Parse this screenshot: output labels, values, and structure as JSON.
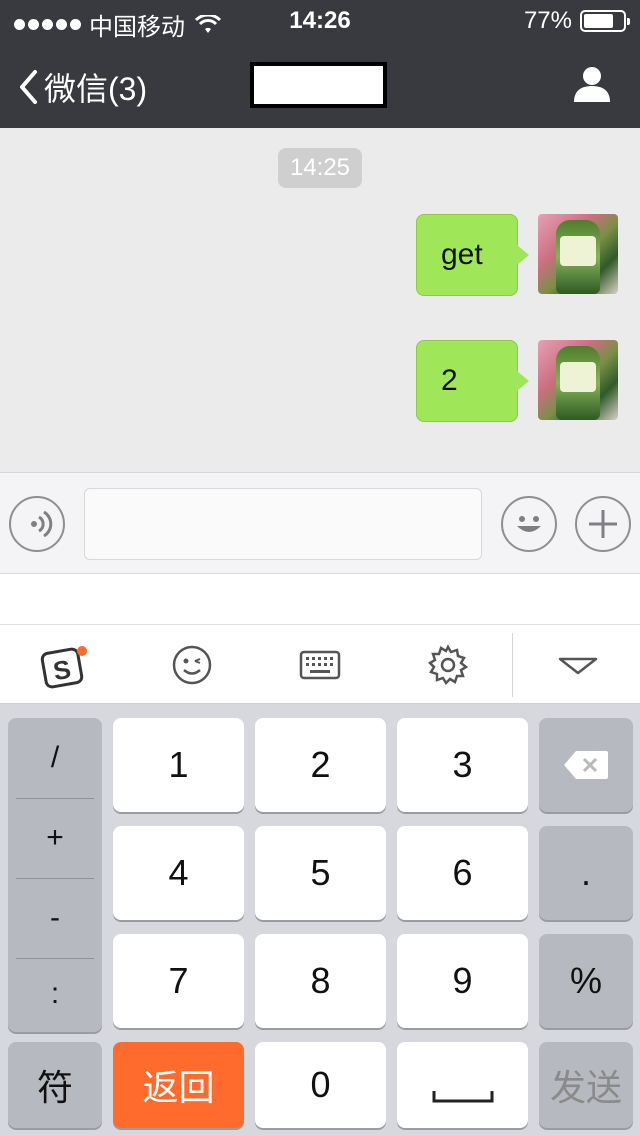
{
  "status_bar": {
    "carrier": "中国移动",
    "time": "14:26",
    "battery_percent": "77%",
    "battery_level": 0.77
  },
  "nav": {
    "back_label": "微信(3)",
    "title": ""
  },
  "chat": {
    "timestamp": "14:25",
    "messages": [
      {
        "text": "get",
        "sender": "self"
      },
      {
        "text": "2",
        "sender": "self"
      }
    ]
  },
  "input": {
    "value": ""
  },
  "keyboard": {
    "toolbar_icons": [
      "sogou-logo-icon",
      "emoji-face-icon",
      "keyboard-icon",
      "gear-icon",
      "collapse-triangle-icon"
    ],
    "symbols": [
      "/",
      "+",
      "-",
      ":"
    ],
    "digits": [
      "1",
      "2",
      "3",
      "4",
      "5",
      "6",
      "7",
      "8",
      "9",
      "0"
    ],
    "dot": ".",
    "percent": "%",
    "symbol_key": "符",
    "return_key": "返回",
    "send_key": "发送",
    "accent_color": "#ff6b2c",
    "bubble_color": "#9fe659"
  }
}
